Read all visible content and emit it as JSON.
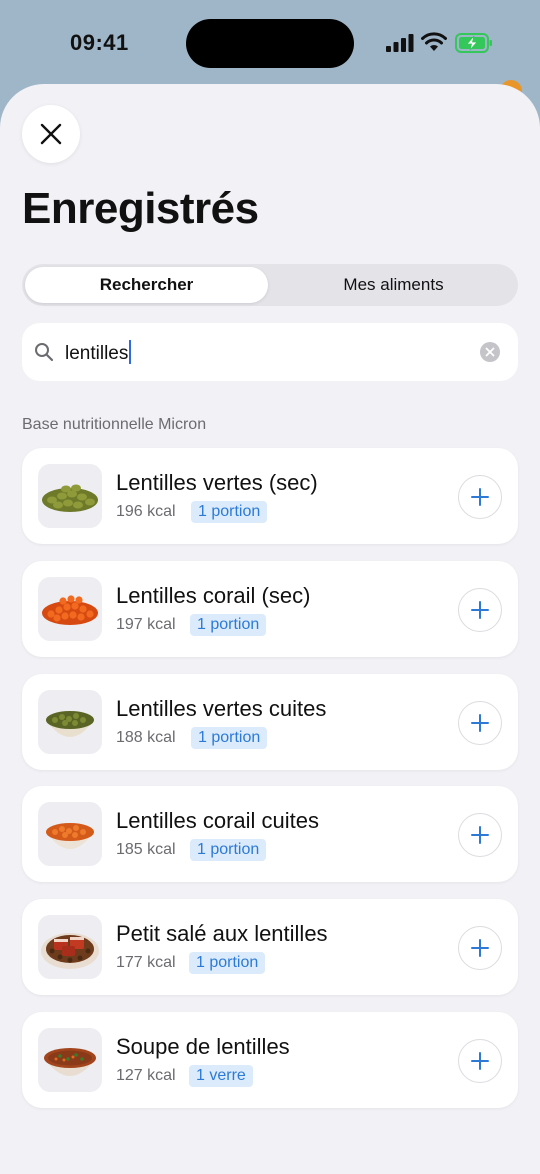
{
  "status_bar": {
    "time": "09:41"
  },
  "header": {
    "title": "Enregistrés"
  },
  "tabs": [
    {
      "label": "Rechercher",
      "active": true
    },
    {
      "label": "Mes aliments",
      "active": false
    }
  ],
  "search": {
    "value": "lentilles"
  },
  "section_label": "Base nutritionnelle Micron",
  "foods": [
    {
      "name": "Lentilles vertes (sec)",
      "kcal": "196 kcal",
      "portion": "1 portion",
      "icon": "green-lentils-icon"
    },
    {
      "name": "Lentilles corail (sec)",
      "kcal": "197 kcal",
      "portion": "1 portion",
      "icon": "coral-lentils-icon"
    },
    {
      "name": "Lentilles vertes cuites",
      "kcal": "188 kcal",
      "portion": "1 portion",
      "icon": "cooked-green-lentils-icon"
    },
    {
      "name": "Lentilles corail cuites",
      "kcal": "185 kcal",
      "portion": "1 portion",
      "icon": "cooked-coral-lentils-icon"
    },
    {
      "name": "Petit salé aux lentilles",
      "kcal": "177 kcal",
      "portion": "1 portion",
      "icon": "petit-sale-icon"
    },
    {
      "name": "Soupe de lentilles",
      "kcal": "127 kcal",
      "portion": "1 verre",
      "icon": "lentil-soup-icon"
    }
  ],
  "colors": {
    "accent": "#2d7ad6",
    "badge_bg": "#dbebfb",
    "sheet_bg": "#f2f2f6",
    "battery": "#34c759"
  }
}
